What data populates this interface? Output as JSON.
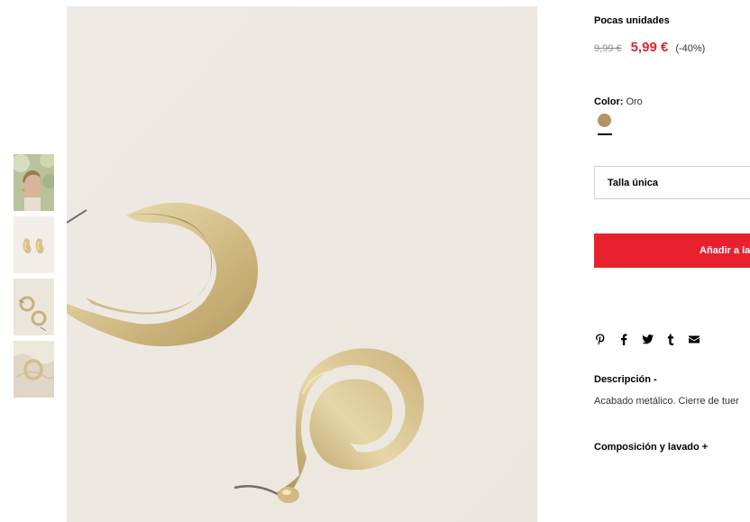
{
  "thumbnails": [
    {
      "name": "model wearing earrings"
    },
    {
      "name": "earrings front view"
    },
    {
      "name": "earrings flat lay"
    },
    {
      "name": "earrings on fabric"
    }
  ],
  "product": {
    "stock_status": "Pocas unidades",
    "price_old": "9,99 €",
    "price_new": "5,99 €",
    "discount": "(-40%)",
    "color_label": "Color:",
    "color_value": "Oro",
    "swatch_color": "#b59463",
    "size": "Talla única",
    "add_button": "Añadir a la",
    "description_title": "Descripción -",
    "description_text": "Acabado metálico. Cierre de tuer",
    "composition_title": "Composición y lavado +"
  },
  "share_icons": [
    "pinterest-icon",
    "facebook-icon",
    "twitter-icon",
    "tumblr-icon",
    "email-icon"
  ],
  "colors": {
    "accent_red": "#e9212f",
    "price_red": "#e3222f",
    "gold": "#b59463"
  }
}
